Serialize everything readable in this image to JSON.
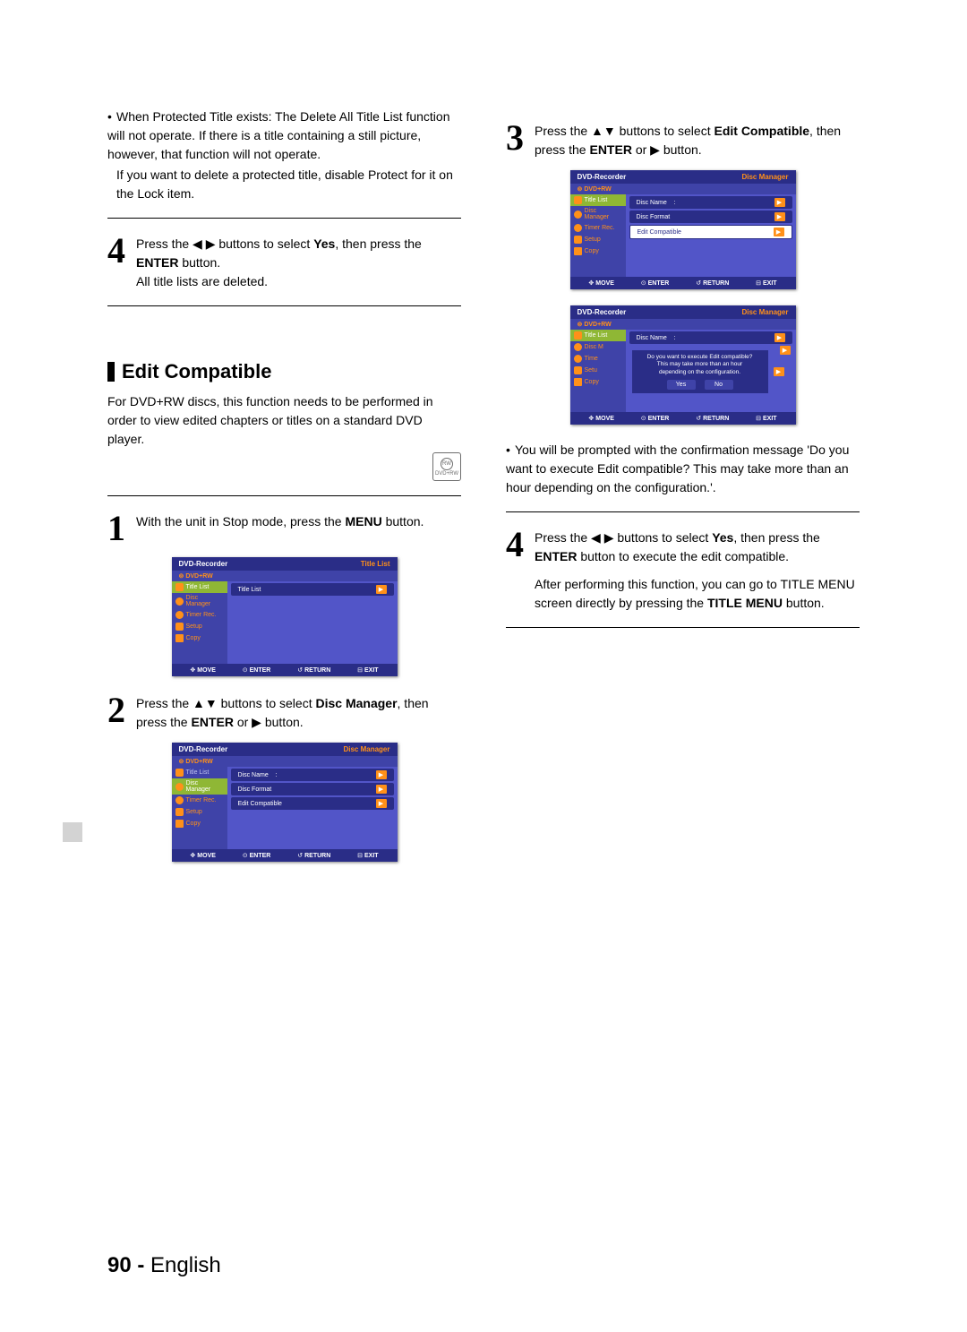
{
  "left": {
    "protected_bullet": "When Protected Title exists: The Delete All Title List function will not operate. If there is a title containing a still picture, however, that function will not operate.",
    "protected_note": "If you want to delete a protected title, disable Protect for it on the Lock item.",
    "step4a": {
      "num": "4",
      "text_pre": "Press the ",
      "text_mid": " buttons to select ",
      "yes": "Yes",
      "text_post": ", then press the ",
      "enter": "ENTER",
      "text_end": " button.",
      "sub": "All title lists are deleted."
    },
    "section": {
      "title": "Edit Compatible",
      "desc": "For DVD+RW discs, this function needs to be performed in order to view edited chapters or titles on a standard DVD player.",
      "icon_label": "DVD+RW"
    },
    "step1": {
      "num": "1",
      "text_pre": "With the unit in Stop mode, press the ",
      "menu": "MENU",
      "text_post": " button."
    },
    "step2": {
      "num": "2",
      "text_pre": "Press the ",
      "text_mid": " buttons to select ",
      "target": "Disc Manager",
      "text_post": ", then press the ",
      "enter": "ENTER",
      "text_or": " or ",
      "text_end": " button."
    }
  },
  "right": {
    "step3": {
      "num": "3",
      "text_pre": "Press the ",
      "text_mid": " buttons to select ",
      "target": "Edit Compatible",
      "text_post": ", then press the ",
      "enter": "ENTER",
      "text_or": " or ",
      "text_end": " button."
    },
    "prompt_bullet": "You will be prompted with the confirmation message 'Do you want to execute Edit compatible? This may take more than an hour depending on the configuration.'.",
    "step4b": {
      "num": "4",
      "text_pre": "Press the ",
      "text_mid": " buttons to select ",
      "yes": "Yes",
      "text_post": ", then press the ",
      "enter": "ENTER",
      "text_end": " button to execute the edit compatible.",
      "sub1": "After performing this function, you can go to TITLE MENU screen directly by pressing the ",
      "titlemenu": "TITLE MENU",
      "sub2": " button."
    }
  },
  "osd_common": {
    "recorder": "DVD-Recorder",
    "dvdrw": "DVD+RW",
    "side": {
      "title_list": "Title List",
      "disc_manager": "Disc Manager",
      "timer_rec": "Timer Rec.",
      "setup": "Setup",
      "copy": "Copy"
    },
    "disc_name": "Disc Name",
    "disc_format": "Disc Format",
    "edit_compatible": "Edit Compatible",
    "footer": {
      "move": "MOVE",
      "enter": "ENTER",
      "return": "RETURN",
      "exit": "EXIT"
    }
  },
  "osd1_right": "Title List",
  "osd1_main_item": "Title List",
  "osd2_right": "Disc Manager",
  "osd_popup": {
    "line1": "Do you want to execute Edit compatible?",
    "line2": "This may take more than an hour",
    "line3": "depending on the configuration.",
    "yes": "Yes",
    "no": "No"
  },
  "osd_side_short": {
    "disc": "Disc M",
    "time": "Time",
    "setu": "Setu",
    "copy": "Copy"
  },
  "footer": {
    "page": "90 - ",
    "lang": "English"
  },
  "glyphs": {
    "left": "◀",
    "right": "▶",
    "up": "▲",
    "down": "▼",
    "updown": "▲▼",
    "leftright": "◀ ▶",
    "bullet": "•",
    "disc": "⊚",
    "enter_ic": "⊙",
    "return_ic": "↺",
    "exit_ic": "⊟",
    "move_ic": "✥"
  }
}
